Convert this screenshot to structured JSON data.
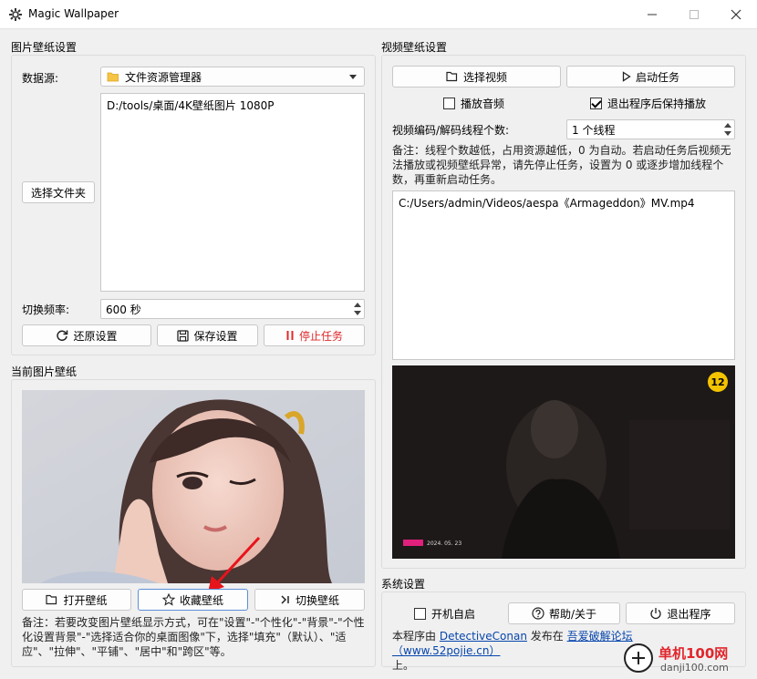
{
  "window": {
    "title": "Magic Wallpaper",
    "icon": "gear-icon"
  },
  "image_settings": {
    "title": "图片壁纸设置",
    "source_label": "数据源:",
    "source_value": "文件资源管理器",
    "select_folder_label": "选择文件夹",
    "folders": [
      "D:/tools/桌面/4K壁纸图片 1080P"
    ],
    "interval_label": "切换频率:",
    "interval_value": "600 秒",
    "restore_label": "还原设置",
    "save_label": "保存设置",
    "stop_label": "停止任务"
  },
  "current_wallpaper": {
    "title": "当前图片壁纸",
    "open_label": "打开壁纸",
    "favorite_label": "收藏壁纸",
    "switch_label": "切换壁纸",
    "note": "备注：若要改变图片壁纸显示方式，可在\"设置\"-\"个性化\"-\"背景\"-\"个性化设置背景\"-\"选择适合你的桌面图像\"下，选择\"填充\"（默认）、\"适应\"、\"拉伸\"、\"平铺\"、\"居中\"和\"跨区\"等。"
  },
  "video_settings": {
    "title": "视频壁纸设置",
    "select_video_label": "选择视频",
    "start_task_label": "启动任务",
    "play_audio_label": "播放音频",
    "play_audio_checked": false,
    "keep_playing_label": "退出程序后保持播放",
    "keep_playing_checked": true,
    "threads_label": "视频编码/解码线程个数:",
    "threads_value": "1 个线程",
    "note": "备注：线程个数越低，占用资源越低，0 为自动。若启动任务后视频无法播放或视频壁纸异常，请先停止任务，设置为 0 或逐步增加线程个数，再重新启动任务。",
    "videos": [
      "C:/Users/admin/Videos/aespa《Armageddon》MV.mp4"
    ],
    "preview_badge": "12",
    "preview_watermark": "2024. 05. 23"
  },
  "system_settings": {
    "title": "系统设置",
    "autostart_label": "开机自启",
    "autostart_checked": false,
    "help_label": "帮助/关于",
    "exit_label": "退出程序",
    "footer_prefix": "本程序由 ",
    "author": "DetectiveConan",
    "footer_mid": " 发布在 ",
    "forum": "吾爱破解论坛（www.52pojie.cn）",
    "footer_suffix": "上。"
  },
  "site_watermark": {
    "name": "单机100网",
    "url": "danji100.com"
  },
  "colors": {
    "accent_red": "#e0282a",
    "link_blue": "#0645ad",
    "badge_yellow": "#f4c400",
    "arrow_red": "#e8141c"
  }
}
